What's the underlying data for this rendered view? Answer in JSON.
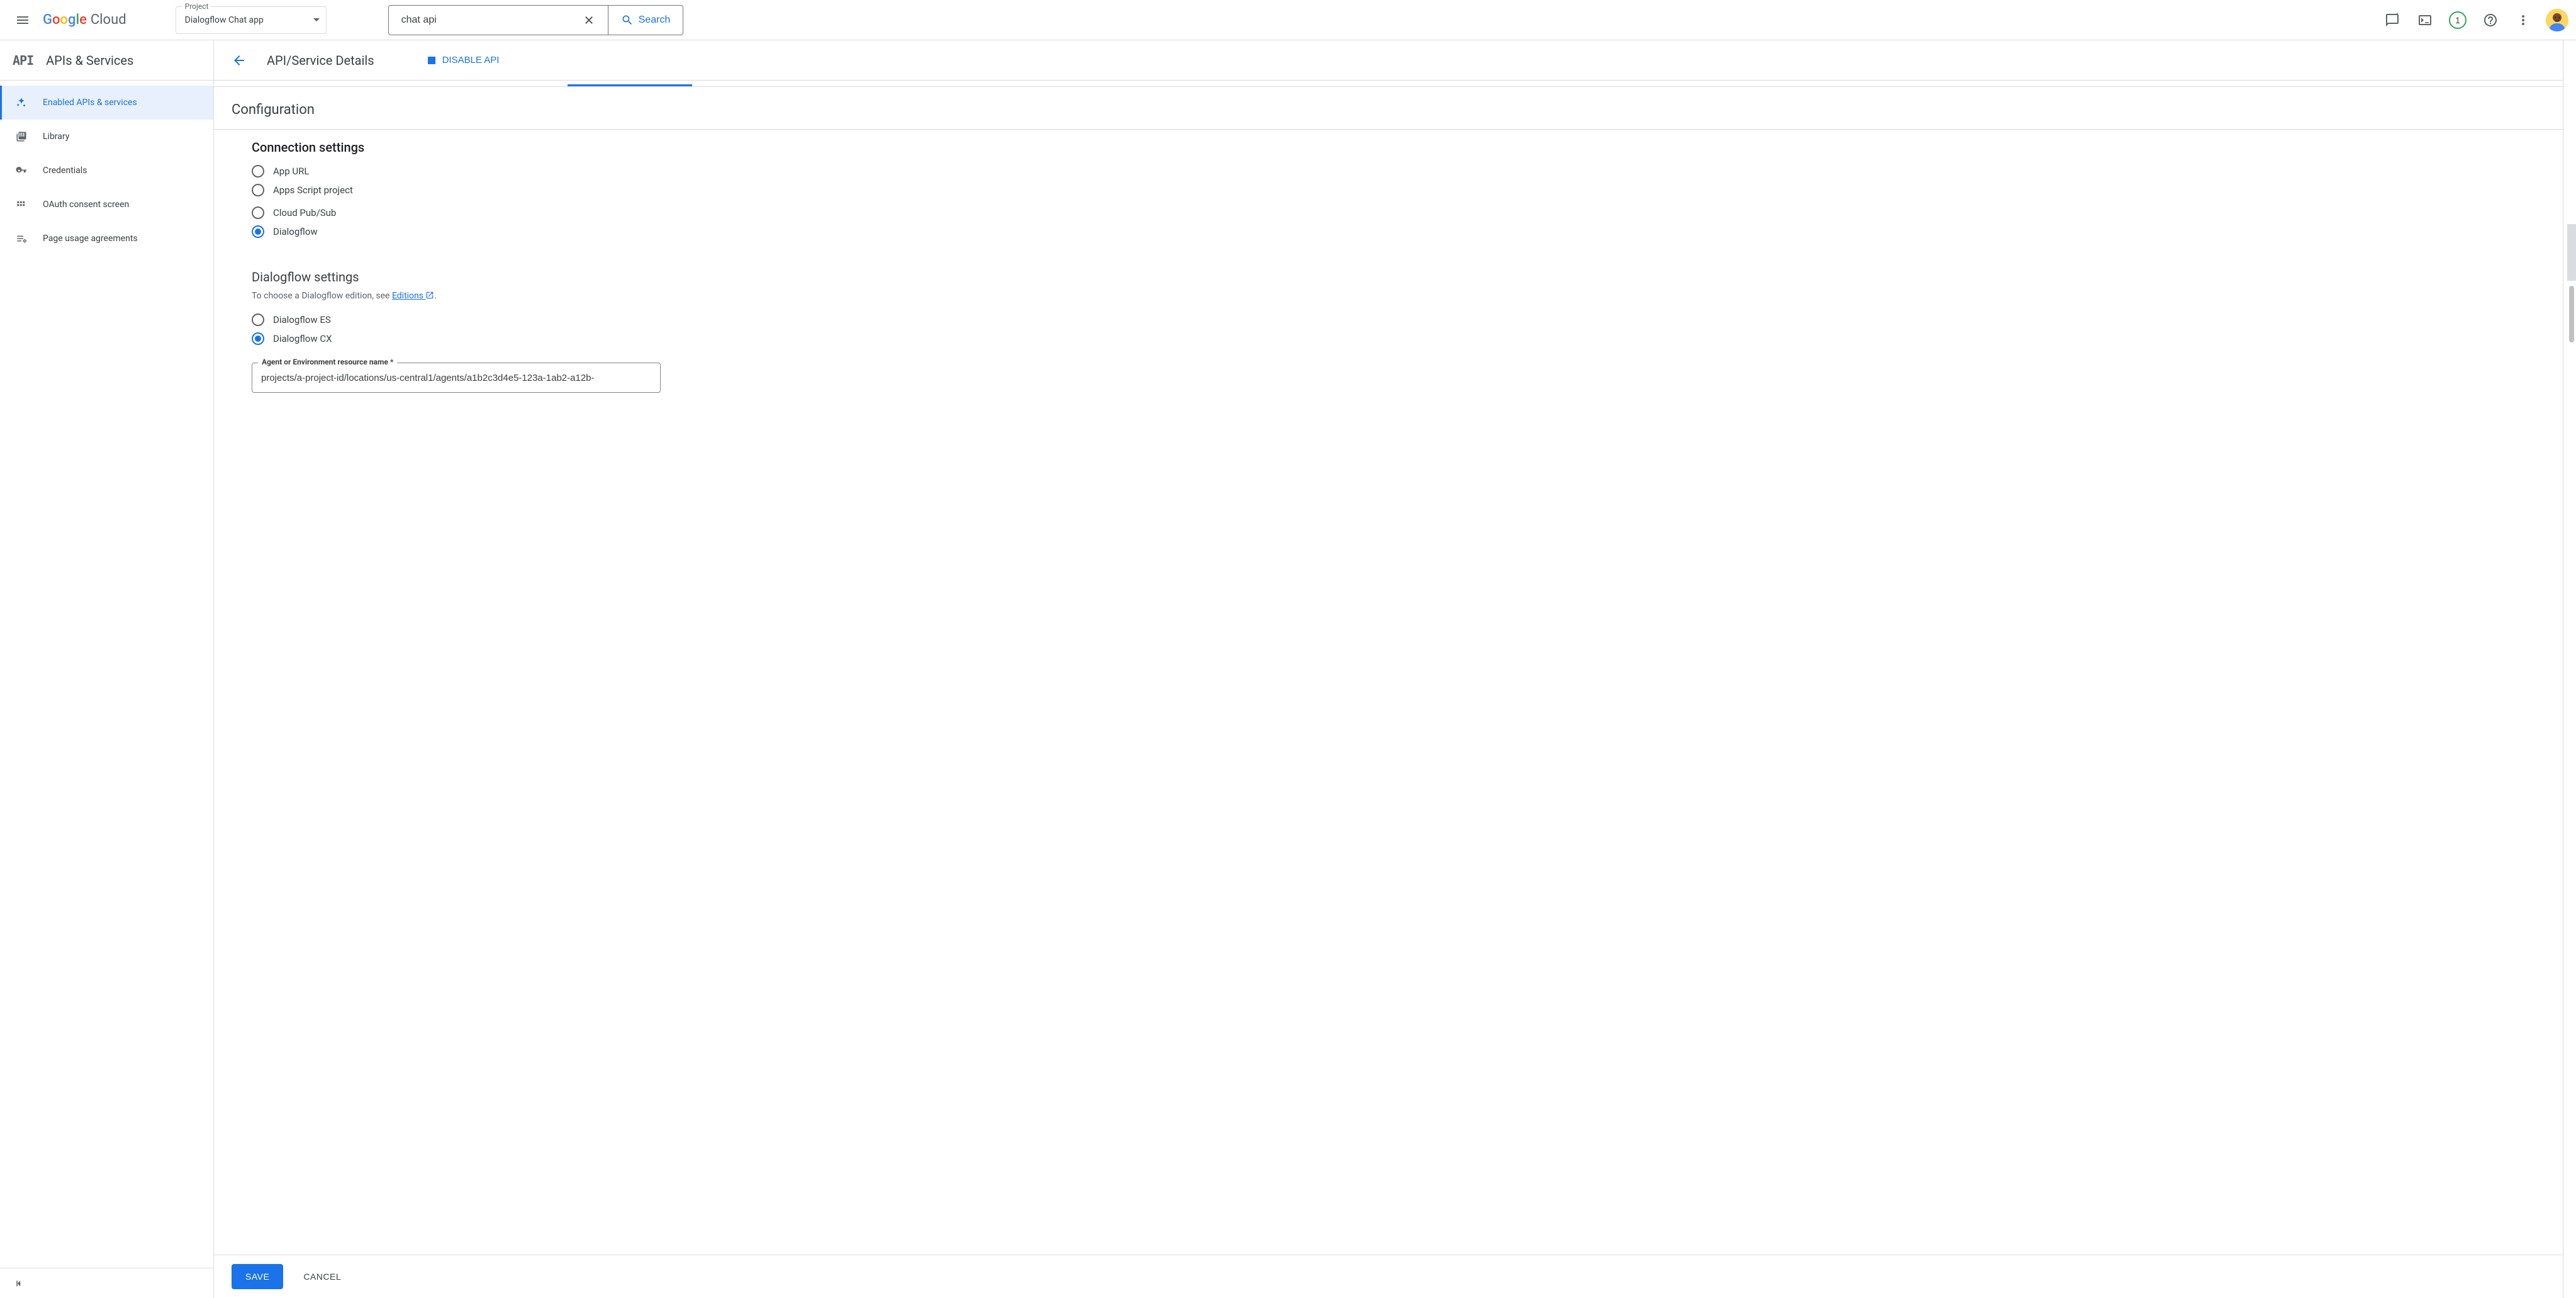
{
  "topbar": {
    "logo_cloud": "Cloud",
    "project_label": "Project",
    "project_name": "Dialogflow Chat app",
    "search_value": "chat api",
    "search_button": "Search",
    "notification_count": "1"
  },
  "leftnav": {
    "title": "APIs & Services",
    "items": [
      {
        "label": "Enabled APIs & services",
        "active": true
      },
      {
        "label": "Library",
        "active": false
      },
      {
        "label": "Credentials",
        "active": false
      },
      {
        "label": "OAuth consent screen",
        "active": false
      },
      {
        "label": "Page usage agreements",
        "active": false
      }
    ]
  },
  "main": {
    "page_title": "API/Service Details",
    "disable_label": "DISABLE API",
    "section_title": "Configuration",
    "connection": {
      "title": "Connection settings",
      "options": [
        {
          "label": "App URL",
          "selected": false
        },
        {
          "label": "Apps Script project",
          "selected": false
        },
        {
          "label": "Cloud Pub/Sub",
          "selected": false
        },
        {
          "label": "Dialogflow",
          "selected": true
        }
      ]
    },
    "dialogflow": {
      "title": "Dialogflow settings",
      "helper_prefix": "To choose a Dialogflow edition, see ",
      "helper_link": "Editions",
      "options": [
        {
          "label": "Dialogflow ES",
          "selected": false
        },
        {
          "label": "Dialogflow CX",
          "selected": true
        }
      ],
      "field_label": "Agent or Environment resource name *",
      "field_value": "projects/a-project-id/locations/us-central1/agents/a1b2c3d4e5-123a-1ab2-a12b-"
    },
    "footer": {
      "save": "SAVE",
      "cancel": "CANCEL"
    }
  }
}
